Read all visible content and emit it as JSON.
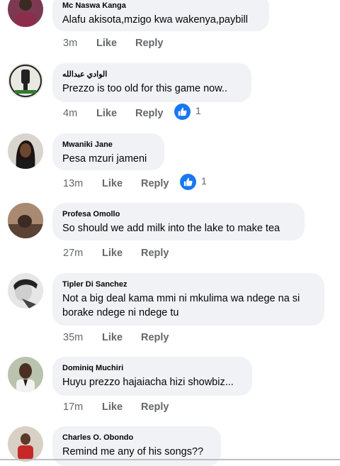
{
  "comments": [
    {
      "author": "Mc Naswa Kanga",
      "text": "Alafu akisota,mzigo kwa wakenya,paybill",
      "time": "3m",
      "like": "Like",
      "reply": "Reply",
      "reactions": ""
    },
    {
      "author": "الوادي عبدالله",
      "text": "Prezzo is too old for this game now..",
      "time": "4m",
      "like": "Like",
      "reply": "Reply",
      "reactions": "1"
    },
    {
      "author": "Mwaniki Jane",
      "text": "Pesa mzuri jameni",
      "time": "13m",
      "like": "Like",
      "reply": "Reply",
      "reactions": "1"
    },
    {
      "author": "Profesa Omollo",
      "text": "So should we add milk into the lake to make tea",
      "time": "27m",
      "like": "Like",
      "reply": "Reply",
      "reactions": ""
    },
    {
      "author": "Tipler Di Sanchez",
      "text_line1": "Not a big deal kama mmi ni mkulima wa ndege na si",
      "text_line2": "borake ndege ni ndege tu",
      "time": "35m",
      "like": "Like",
      "reply": "Reply",
      "reactions": ""
    },
    {
      "author": "Dominiq Muchiri",
      "text": "Huyu prezzo hajaiacha hizi showbiz...",
      "time": "17m",
      "like": "Like",
      "reply": "Reply",
      "reactions": ""
    },
    {
      "author": "Charles O. Obondo",
      "text": "Remind me any of his songs??",
      "time": "",
      "like": "",
      "reply": "",
      "reactions": ""
    }
  ],
  "colors": {
    "bubble": "#f0f2f5",
    "meta": "#65676b",
    "like_blue": "#1877f2"
  },
  "icons": {
    "reaction": "thumbs-up-icon"
  }
}
